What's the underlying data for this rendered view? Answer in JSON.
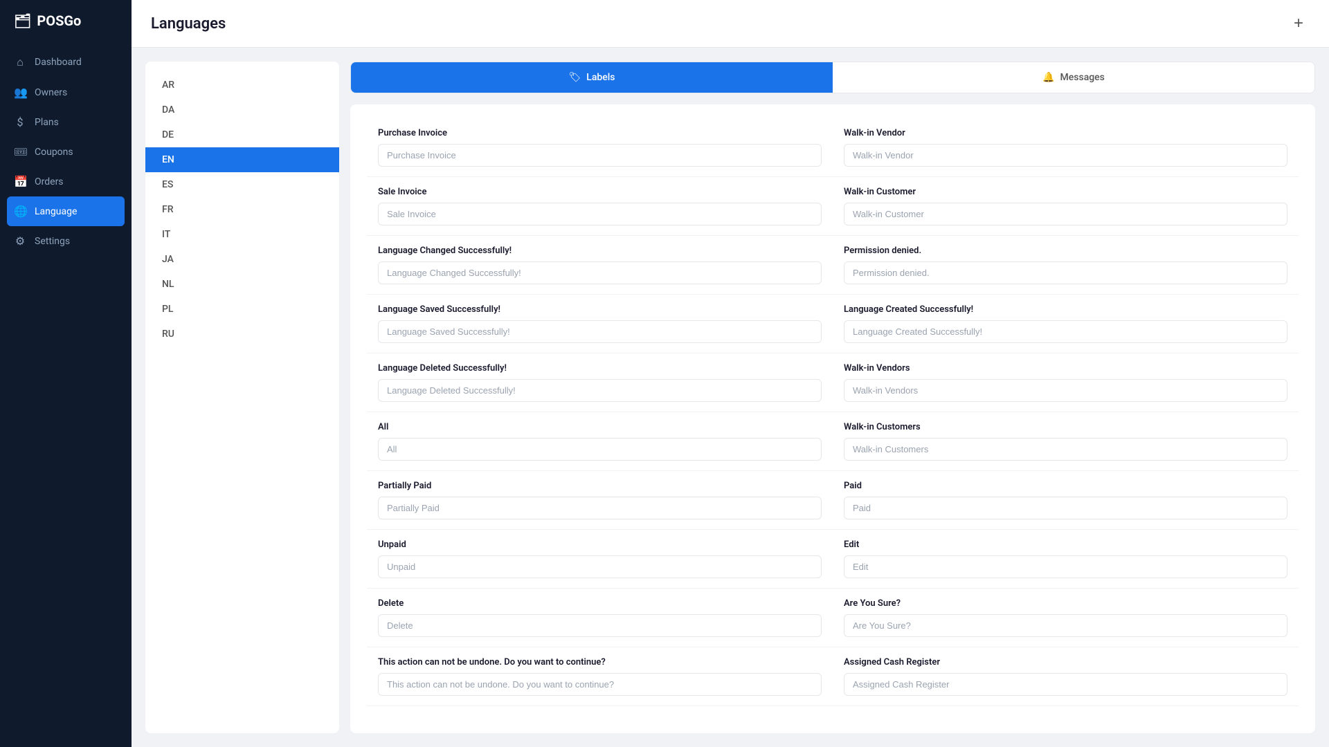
{
  "app": {
    "name": "POSGo",
    "logo_icon": "🗂"
  },
  "sidebar": {
    "nav_items": [
      {
        "id": "dashboard",
        "label": "Dashboard",
        "icon": "⌂",
        "active": false
      },
      {
        "id": "owners",
        "label": "Owners",
        "icon": "👥",
        "active": false
      },
      {
        "id": "plans",
        "label": "Plans",
        "icon": "$",
        "active": false
      },
      {
        "id": "coupons",
        "label": "Coupons",
        "icon": "🎟",
        "active": false
      },
      {
        "id": "orders",
        "label": "Orders",
        "icon": "📅",
        "active": false
      },
      {
        "id": "language",
        "label": "Language",
        "icon": "🌐",
        "active": true
      },
      {
        "id": "settings",
        "label": "Settings",
        "icon": "⚙",
        "active": false
      }
    ]
  },
  "page": {
    "title": "Languages",
    "add_button_label": "+"
  },
  "languages": [
    {
      "code": "AR",
      "active": false
    },
    {
      "code": "DA",
      "active": false
    },
    {
      "code": "DE",
      "active": false
    },
    {
      "code": "EN",
      "active": true
    },
    {
      "code": "ES",
      "active": false
    },
    {
      "code": "FR",
      "active": false
    },
    {
      "code": "IT",
      "active": false
    },
    {
      "code": "JA",
      "active": false
    },
    {
      "code": "NL",
      "active": false
    },
    {
      "code": "PL",
      "active": false
    },
    {
      "code": "RU",
      "active": false
    }
  ],
  "tabs": [
    {
      "id": "labels",
      "label": "Labels",
      "icon": "🏷",
      "active": true
    },
    {
      "id": "messages",
      "label": "Messages",
      "icon": "🔔",
      "active": false
    }
  ],
  "labels": [
    {
      "key": "purchase_invoice_label",
      "field_label": "Purchase Invoice",
      "value": "Purchase Invoice",
      "col": "left"
    },
    {
      "key": "walk_in_vendor_label",
      "field_label": "Walk-in Vendor",
      "value": "Walk-in Vendor",
      "col": "right"
    },
    {
      "key": "sale_invoice_label",
      "field_label": "Sale Invoice",
      "value": "Sale Invoice",
      "col": "left"
    },
    {
      "key": "walk_in_customer_label",
      "field_label": "Walk-in Customer",
      "value": "Walk-in Customer",
      "col": "right"
    },
    {
      "key": "language_changed_label",
      "field_label": "Language Changed Successfully!",
      "value": "Language Changed Successfully!",
      "col": "left"
    },
    {
      "key": "permission_denied_label",
      "field_label": "Permission denied.",
      "value": "Permission denied.",
      "col": "right"
    },
    {
      "key": "language_saved_label",
      "field_label": "Language Saved Successfully!",
      "value": "Language Saved Successfully!",
      "col": "left"
    },
    {
      "key": "language_created_label",
      "field_label": "Language Created Successfully!",
      "value": "Language Created Successfully!",
      "col": "right"
    },
    {
      "key": "language_deleted_label",
      "field_label": "Language Deleted Successfully!",
      "value": "Language Deleted Successfully!",
      "col": "left"
    },
    {
      "key": "walk_in_vendors_label",
      "field_label": "Walk-in Vendors",
      "value": "Walk-in Vendors",
      "col": "right"
    },
    {
      "key": "all_label",
      "field_label": "All",
      "value": "All",
      "col": "left"
    },
    {
      "key": "walk_in_customers_label",
      "field_label": "Walk-in Customers",
      "value": "Walk-in Customers",
      "col": "right"
    },
    {
      "key": "partially_paid_label",
      "field_label": "Partially Paid",
      "value": "Partially Paid",
      "col": "left"
    },
    {
      "key": "paid_label",
      "field_label": "Paid",
      "value": "Paid",
      "col": "right"
    },
    {
      "key": "unpaid_label",
      "field_label": "Unpaid",
      "value": "Unpaid",
      "col": "left"
    },
    {
      "key": "edit_label",
      "field_label": "Edit",
      "value": "Edit",
      "col": "right"
    },
    {
      "key": "delete_label",
      "field_label": "Delete",
      "value": "Delete",
      "col": "left"
    },
    {
      "key": "are_you_sure_label",
      "field_label": "Are You Sure?",
      "value": "Are You Sure?",
      "col": "right"
    },
    {
      "key": "action_undone_label",
      "field_label": "This action can not be undone. Do you want to continue?",
      "value": "This action can not be undone. Do you want to continue?",
      "col": "left"
    },
    {
      "key": "assigned_cash_register_label",
      "field_label": "Assigned Cash Register",
      "value": "Assigned Cash Register",
      "col": "right"
    }
  ]
}
